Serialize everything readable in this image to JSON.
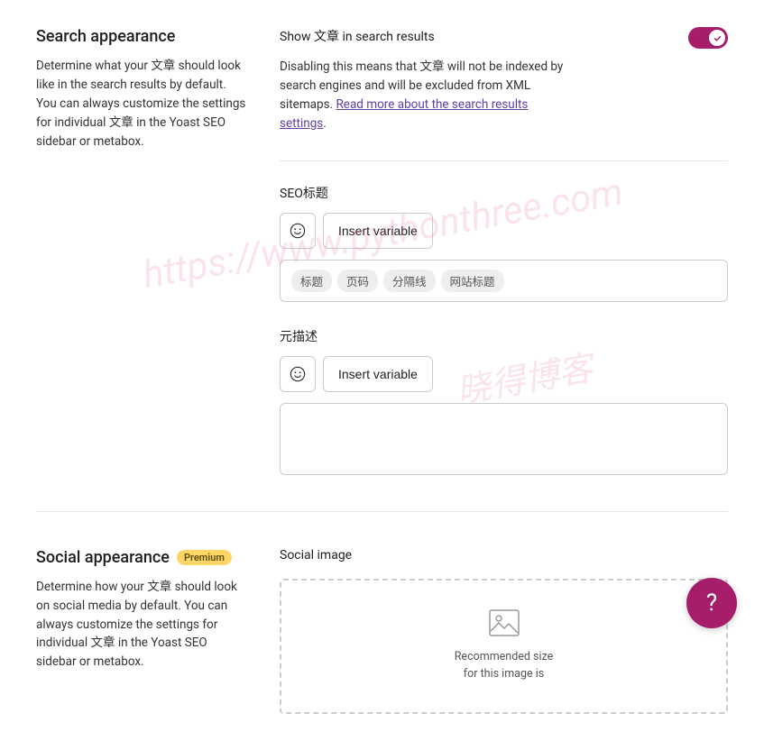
{
  "search": {
    "title": "Search appearance",
    "desc": "Determine what your 文章 should look like in the search results by default. You can always customize the settings for individual 文章 in the Yoast SEO sidebar or metabox.",
    "toggle_label": "Show 文章 in search results",
    "toggle_on": true,
    "toggle_desc_before": "Disabling this means that 文章 will not be indexed by search engines and will be excluded from XML sitemaps. ",
    "toggle_link": "Read more about the search results settings",
    "toggle_desc_after": ".",
    "seo_title_label": "SEO标题",
    "insert_variable": "Insert variable",
    "seo_title_tags": [
      "标题",
      "页码",
      "分隔线",
      "网站标题"
    ],
    "meta_desc_label": "元描述"
  },
  "social": {
    "title": "Social appearance",
    "premium": "Premium",
    "desc": "Determine how your 文章 should look on social media by default. You can always customize the settings for individual 文章 in the Yoast SEO sidebar or metabox.",
    "image_label": "Social image",
    "drop_line1": "Recommended size",
    "drop_line2": "for this image is"
  },
  "help": "?",
  "watermarks": {
    "wm1": "https://www.pythonthree.com",
    "wm2": "晓得博客"
  }
}
